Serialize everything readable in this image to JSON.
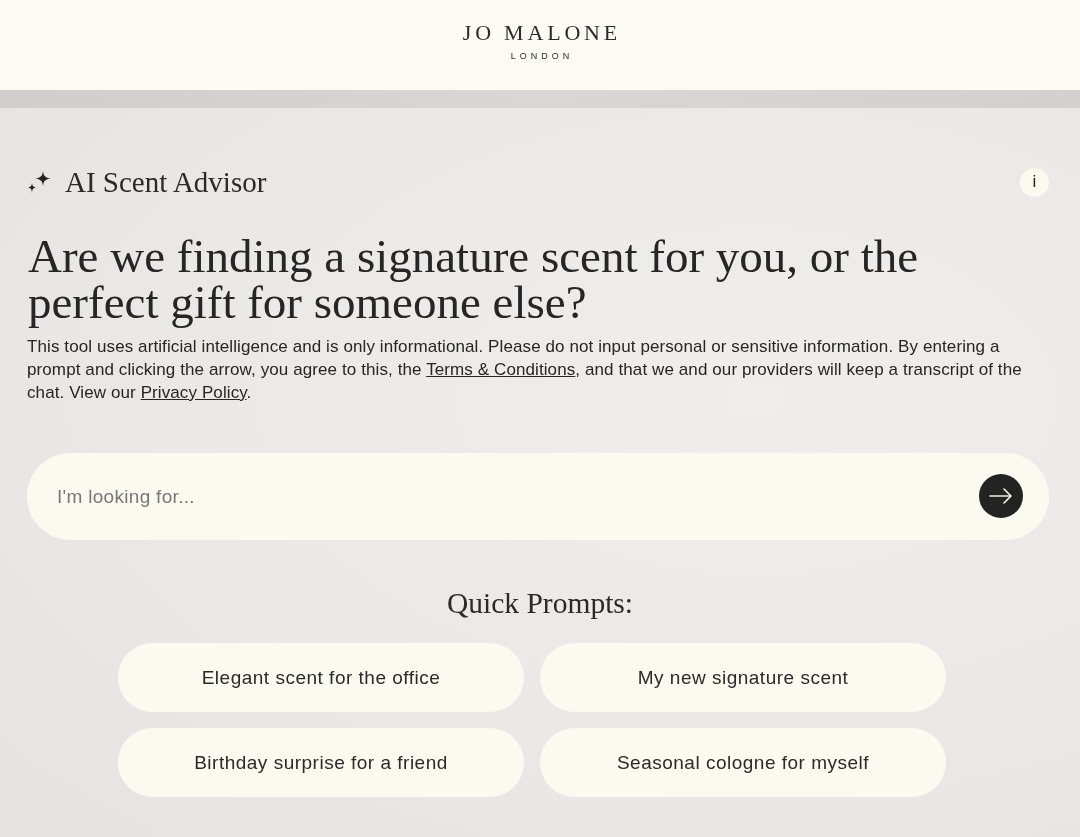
{
  "header": {
    "brand": "JO MALONE",
    "tagline": "LONDON"
  },
  "advisor": {
    "title": "AI Scent Advisor",
    "info_button": "i"
  },
  "headline": "Are we finding a signature scent for you, or the perfect gift for someone else?",
  "disclaimer": [
    {
      "kind": "text",
      "text": "This tool uses artificial intelligence and is only informational. Please do not input personal or sensitive information. By entering a prompt and clicking the arrow, you agree to this, the "
    },
    {
      "kind": "link",
      "text": "Terms & Conditions"
    },
    {
      "kind": "text",
      "text": ", and that we and our providers will keep a transcript of the chat. View our "
    },
    {
      "kind": "link",
      "text": "Privacy Policy"
    },
    {
      "kind": "text",
      "text": "."
    }
  ],
  "search": {
    "placeholder": "I'm looking for..."
  },
  "quick_prompts": {
    "title": "Quick Prompts:",
    "items": [
      "Elegant scent for the office",
      "My new signature scent",
      "Birthday surprise for a friend",
      "Seasonal cologne for myself"
    ]
  }
}
